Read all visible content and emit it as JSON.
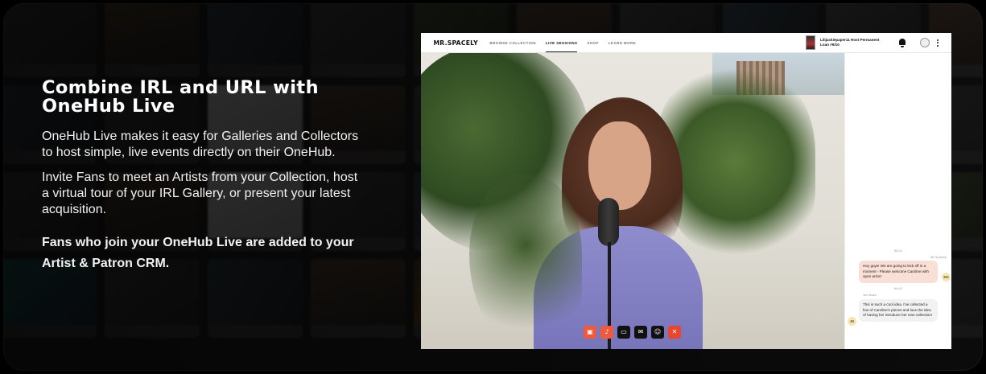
{
  "hero": {
    "headline": "Combine IRL and URL with OneHub Live",
    "paragraph_1": "OneHub Live makes it easy for Galleries and Collectors to host simple, live events directly on their OneHub.",
    "paragraph_2": "Invite Fans to meet an Artists from your Collection, host a virtual tour of your IRL Gallery, or present your latest acquisition.",
    "paragraph_3": "Fans who join your OneHub Live are added to your Artist & Patron CRM."
  },
  "app": {
    "logo": "MR.SPACELY",
    "nav": [
      {
        "label": "BROWSE COLLECTION",
        "active": false
      },
      {
        "label": "LIVE SESSIONS",
        "active": true
      },
      {
        "label": "SHOP",
        "active": false
      },
      {
        "label": "LEARN MORE",
        "active": false
      }
    ],
    "collection": "Lilijackiepaper11 Host Permanent Loan #9/10",
    "icons": {
      "notifications": "bell-icon",
      "profile": "user-icon",
      "menu": "kebab-menu-icon"
    }
  },
  "controls": [
    {
      "name": "camera-icon",
      "glyph": "▣",
      "style": "red"
    },
    {
      "name": "mic-muted-icon",
      "glyph": "♪",
      "style": "red"
    },
    {
      "name": "screen-share-icon",
      "glyph": "▭",
      "style": "dark"
    },
    {
      "name": "chat-icon",
      "glyph": "✉",
      "style": "dark"
    },
    {
      "name": "participants-icon",
      "glyph": "☺",
      "style": "dark"
    },
    {
      "name": "leave-icon",
      "glyph": "✕",
      "style": "orange"
    }
  ],
  "chat": {
    "messages": [
      {
        "time": "56:41",
        "sender": "Mr Spacely",
        "initials": "MS",
        "text": "Hey guys! We are going to kick off in a moment - Please welcome Caroline with open arms!"
      },
      {
        "time": "56:42",
        "sender": "Jen Nash",
        "initials": "JN",
        "text": "This is such a cool idea. I've collected a few of Caroline's pieces and love the idea of having her introduce her new collection!"
      }
    ]
  },
  "colors": {
    "accent": "#ef5a3c",
    "host_bubble": "#f9dfd6",
    "fan_bubble": "#f2f2f2",
    "nav_active": "#111111"
  }
}
